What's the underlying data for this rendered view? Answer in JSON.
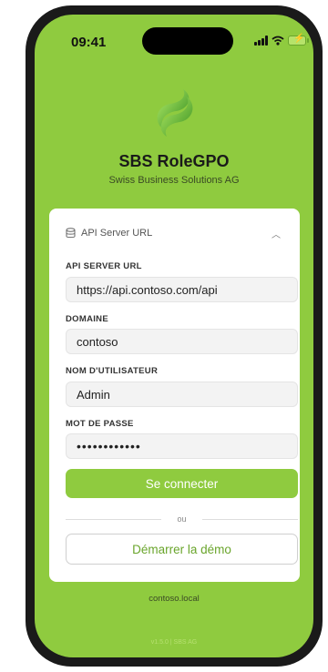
{
  "status_bar": {
    "time": "09:41"
  },
  "app": {
    "title": "SBS RoleGPO",
    "subtitle": "Swiss Business Solutions AG"
  },
  "card": {
    "section_label": "API Server URL",
    "fields": {
      "api_url": {
        "label": "API SERVER URL",
        "value": "https://api.contoso.com/api"
      },
      "domain": {
        "label": "DOMAINE",
        "value": "contoso"
      },
      "username": {
        "label": "NOM D'UTILISATEUR",
        "value": "Admin"
      },
      "password": {
        "label": "MOT DE PASSE",
        "value": "••••••••••••"
      }
    },
    "connect_label": "Se connecter",
    "or_label": "ou",
    "demo_label": "Démarrer la démo"
  },
  "footer": {
    "server_host": "contoso.local",
    "version": "v1.5.0 | SBS AG"
  },
  "colors": {
    "accent": "#8fcb3f",
    "accent_dark": "#6aa52c",
    "frame": "#1a1a1a"
  },
  "icons": [
    "signal-icon",
    "wifi-icon",
    "battery-icon",
    "database-icon",
    "chevron-up-icon",
    "app-logo"
  ]
}
